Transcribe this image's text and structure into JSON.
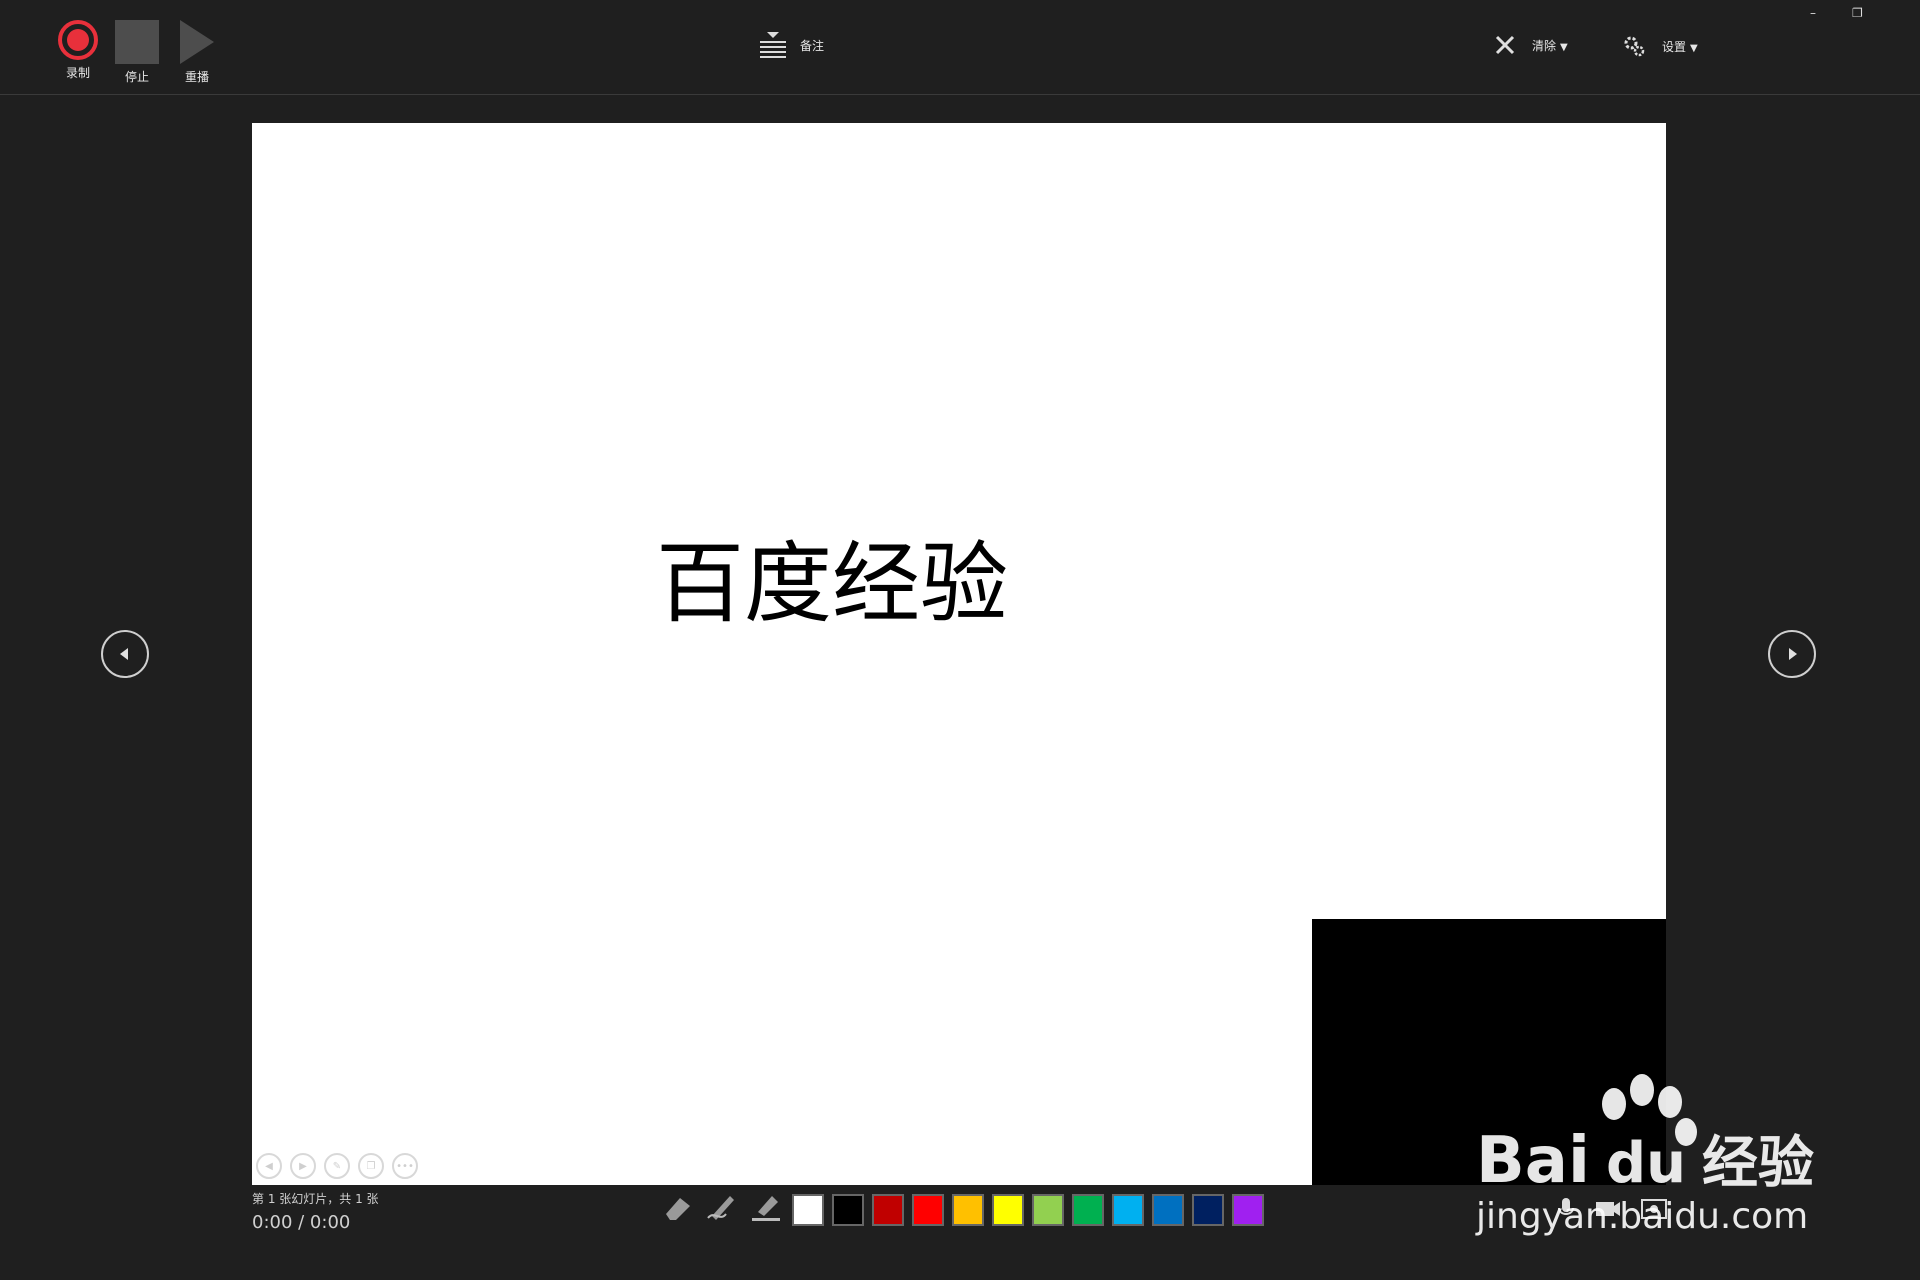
{
  "toolbar": {
    "record_label": "录制",
    "stop_label": "停止",
    "replay_label": "重播",
    "notes_label": "备注",
    "clear_label": "清除",
    "settings_label": "设置"
  },
  "slide": {
    "title": "百度经验"
  },
  "status": {
    "slide_info": "第 1 张幻灯片，共 1 张",
    "timer": "0:00  /  0:00"
  },
  "colors": {
    "record": "#e8303b",
    "palette": [
      "#ffffff",
      "#000000",
      "#c00000",
      "#ff0000",
      "#ffc000",
      "#ffff00",
      "#92d050",
      "#00b050",
      "#00b0f0",
      "#0070c0",
      "#002060",
      "#a020f0"
    ]
  },
  "watermark": {
    "brand": "Bai",
    "brand2": "du",
    "brand3": "经验",
    "url": "jingyan.baidu.com"
  }
}
